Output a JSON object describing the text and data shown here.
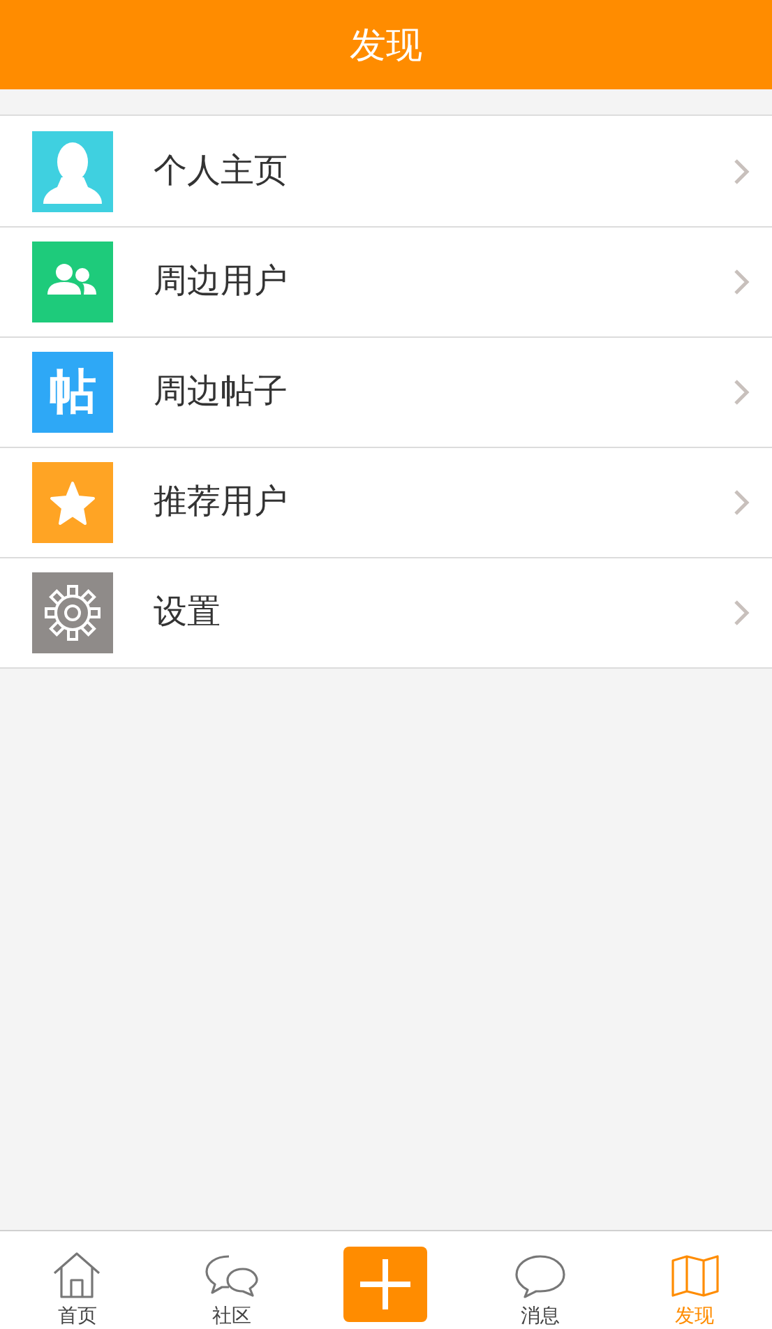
{
  "header": {
    "title": "发现"
  },
  "menu": [
    {
      "kind": "person",
      "label": "个人主页",
      "color": "#3fd0e0"
    },
    {
      "kind": "users",
      "label": "周边用户",
      "color": "#1ecb7b"
    },
    {
      "kind": "glyph",
      "glyph": "帖",
      "label": "周边帖子",
      "color": "#2ea8f6"
    },
    {
      "kind": "star",
      "label": "推荐用户",
      "color": "#ffa424"
    },
    {
      "kind": "gear",
      "label": "设置",
      "color": "#8f8b89"
    }
  ],
  "tab_bar": [
    {
      "kind": "home",
      "label": "首页",
      "selected": false
    },
    {
      "kind": "chat",
      "label": "社区",
      "selected": false
    },
    {
      "kind": "add",
      "selected": false
    },
    {
      "kind": "message",
      "label": "消息",
      "selected": false
    },
    {
      "kind": "discover",
      "label": "发现",
      "selected": true
    }
  ]
}
